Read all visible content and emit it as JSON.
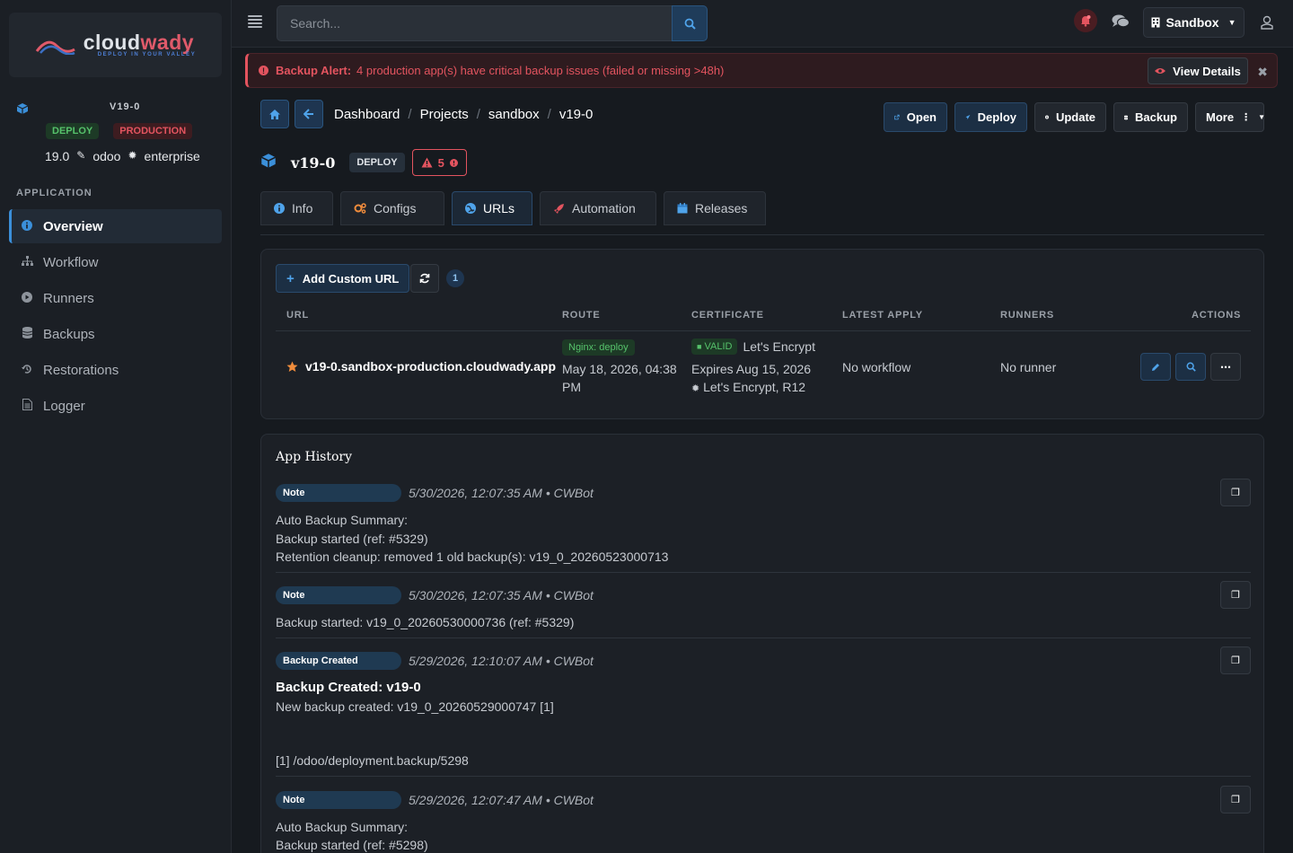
{
  "brand": {
    "name_a": "cloud",
    "name_b": "wady",
    "tagline": "DEPLOY IN YOUR VALLEY"
  },
  "app": {
    "name": "V19-0",
    "badges": [
      "DEPLOY",
      "PRODUCTION"
    ],
    "version": "19.0",
    "platform": "odoo",
    "edition": "enterprise"
  },
  "sidebar": {
    "section": "APPLICATION",
    "items": [
      {
        "label": "Overview",
        "icon": "info-icon",
        "active": true
      },
      {
        "label": "Workflow",
        "icon": "sitemap-icon"
      },
      {
        "label": "Runners",
        "icon": "play-icon"
      },
      {
        "label": "Backups",
        "icon": "database-icon"
      },
      {
        "label": "Restorations",
        "icon": "history-icon"
      },
      {
        "label": "Logger",
        "icon": "file-icon"
      }
    ]
  },
  "topbar": {
    "search_placeholder": "Search...",
    "environment": "Sandbox"
  },
  "alert": {
    "title": "Backup Alert:",
    "message": "4 production app(s) have critical backup issues (failed or missing >48h)",
    "button": "View Details"
  },
  "breadcrumb": [
    "Dashboard",
    "Projects",
    "sandbox",
    "v19-0"
  ],
  "actions": {
    "open": "Open",
    "deploy": "Deploy",
    "update": "Update",
    "backup": "Backup",
    "more": "More"
  },
  "header": {
    "title": "v19-0",
    "badge": "DEPLOY",
    "alert_count": "5"
  },
  "tabs": [
    {
      "label": "Info",
      "icon": "info-icon"
    },
    {
      "label": "Configs",
      "icon": "cogs-icon"
    },
    {
      "label": "URLs",
      "icon": "globe-icon",
      "active": true
    },
    {
      "label": "Automation",
      "icon": "rocket-icon"
    },
    {
      "label": "Releases",
      "icon": "calendar-icon"
    }
  ],
  "urls": {
    "add_button": "Add Custom URL",
    "count": "1",
    "columns": [
      "URL",
      "ROUTE",
      "CERTIFICATE",
      "LATEST APPLY",
      "RUNNERS",
      "ACTIONS"
    ],
    "rows": [
      {
        "url": "v19-0.sandbox-production.cloudwady.app",
        "route_badge": "Nginx: deploy",
        "route_date_1": "May 18, 2026, 04:38",
        "route_date_2": "PM",
        "cert_status": "VALID",
        "cert_issuer": "Let's Encrypt",
        "cert_expires": "Expires Aug 15, 2026",
        "cert_ca": "Let's Encrypt, R12",
        "latest_apply": "No workflow",
        "runners": "No runner"
      }
    ]
  },
  "history": {
    "title": "App History",
    "entries": [
      {
        "tag": "Note",
        "meta": "5/30/2026, 12:07:35 AM • CWBot",
        "lines": [
          "Auto Backup Summary:",
          "Backup started (ref: #5329)",
          "Retention cleanup: removed 1 old backup(s): v19_0_20260523000713"
        ]
      },
      {
        "tag": "Note",
        "meta": "5/30/2026, 12:07:35 AM • CWBot",
        "lines": [
          "Backup started: v19_0_20260530000736 (ref: #5329)"
        ]
      },
      {
        "tag": "Backup Created",
        "meta": "5/29/2026, 12:10:07 AM • CWBot",
        "heading": "Backup Created: v19-0",
        "lines": [
          "New backup created: v19_0_20260529000747 [1]",
          "[1] /odoo/deployment.backup/5298"
        ]
      },
      {
        "tag": "Note",
        "meta": "5/29/2026, 12:07:47 AM • CWBot",
        "lines": [
          "Auto Backup Summary:",
          "Backup started (ref: #5298)"
        ]
      }
    ]
  },
  "colors": {
    "accent": "#3b8fd9",
    "danger": "#e3545f",
    "success": "#56c26b",
    "bg": "#161a1f"
  }
}
